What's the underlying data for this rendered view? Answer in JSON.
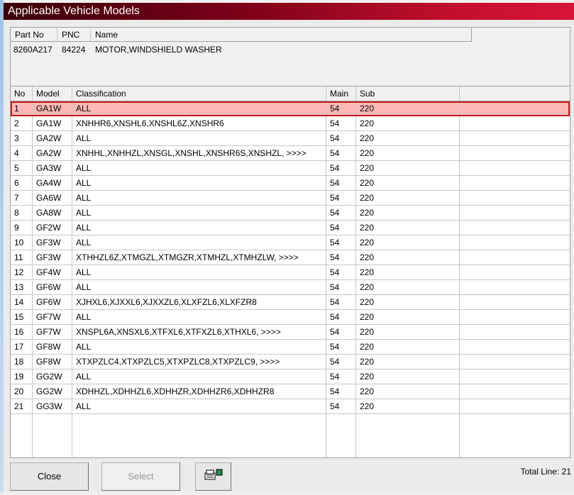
{
  "window": {
    "title": "Applicable Vehicle Models"
  },
  "part": {
    "headers": [
      "Part No",
      "PNC",
      "Name"
    ],
    "part_no": "8260A217",
    "pnc": "84224",
    "name": "MOTOR,WINDSHIELD WASHER"
  },
  "grid": {
    "headers": [
      "No",
      "Model",
      "Classification",
      "Main",
      "Sub"
    ],
    "rows": [
      [
        "1",
        "GA1W",
        "ALL",
        "54",
        "220"
      ],
      [
        "2",
        "GA1W",
        "XNHHR6,XNSHL6,XNSHL6Z,XNSHR6",
        "54",
        "220"
      ],
      [
        "3",
        "GA2W",
        "ALL",
        "54",
        "220"
      ],
      [
        "4",
        "GA2W",
        "XNHHL,XNHHZL,XNSGL,XNSHL,XNSHR6S,XNSHZL,  >>>>",
        "54",
        "220"
      ],
      [
        "5",
        "GA3W",
        "ALL",
        "54",
        "220"
      ],
      [
        "6",
        "GA4W",
        "ALL",
        "54",
        "220"
      ],
      [
        "7",
        "GA6W",
        "ALL",
        "54",
        "220"
      ],
      [
        "8",
        "GA8W",
        "ALL",
        "54",
        "220"
      ],
      [
        "9",
        "GF2W",
        "ALL",
        "54",
        "220"
      ],
      [
        "10",
        "GF3W",
        "ALL",
        "54",
        "220"
      ],
      [
        "11",
        "GF3W",
        "XTHHZL6Z,XTMGZL,XTMGZR,XTMHZL,XTMHZLW,  >>>>",
        "54",
        "220"
      ],
      [
        "12",
        "GF4W",
        "ALL",
        "54",
        "220"
      ],
      [
        "13",
        "GF6W",
        "ALL",
        "54",
        "220"
      ],
      [
        "14",
        "GF6W",
        "XJHXL6,XJXXL6,XJXXZL6,XLXFZL6,XLXFZR8",
        "54",
        "220"
      ],
      [
        "15",
        "GF7W",
        "ALL",
        "54",
        "220"
      ],
      [
        "16",
        "GF7W",
        "XNSPL6A,XNSXL6,XTFXL6,XTFXZL6,XTHXL6,  >>>>",
        "54",
        "220"
      ],
      [
        "17",
        "GF8W",
        "ALL",
        "54",
        "220"
      ],
      [
        "18",
        "GF8W",
        "XTXPZLC4,XTXPZLC5,XTXPZLC8,XTXPZLC9,  >>>>",
        "54",
        "220"
      ],
      [
        "19",
        "GG2W",
        "ALL",
        "54",
        "220"
      ],
      [
        "20",
        "GG2W",
        "XDHHZL,XDHHZL6,XDHHZR,XDHHZR6,XDHHZR8",
        "54",
        "220"
      ],
      [
        "21",
        "GG3W",
        "ALL",
        "54",
        "220"
      ]
    ],
    "selected_row": 0
  },
  "footer": {
    "close": "Close",
    "select": "Select",
    "print_icon": "printer-icon",
    "total": "Total Line: 21"
  }
}
